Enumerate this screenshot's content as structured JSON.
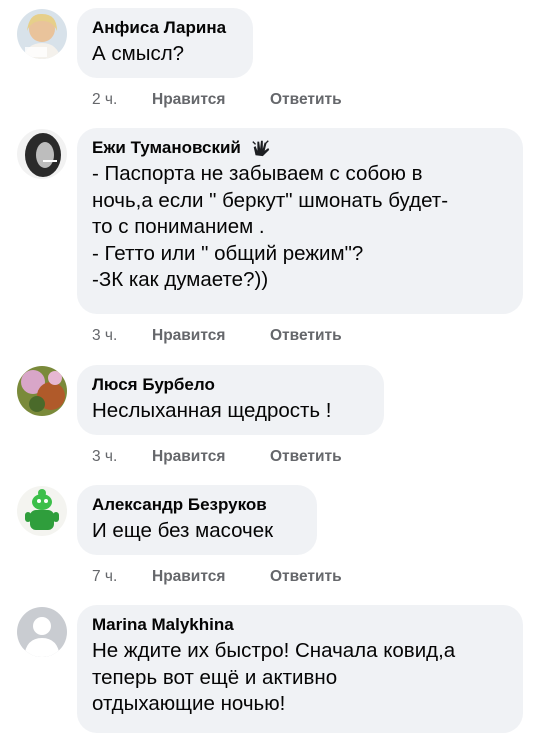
{
  "comments": [
    {
      "author": "Анфиса Ларина",
      "text": "А смысл?",
      "time": "2 ч.",
      "like_label": "Нравится",
      "reply_label": "Ответить",
      "avatar_icon": "profile-photo-icon"
    },
    {
      "author": "Ежи Тумановский",
      "text": "- Паспорта не забываем с собою в\nночь,а если \" беркут\" шмонать будет-\nто с пониманием .\n- Гетто или \" общий режим\"?\n-ЗК как думаете?))",
      "time": "3 ч.",
      "like_label": "Нравится",
      "reply_label": "Ответить",
      "avatar_icon": "profile-photo-icon",
      "badge_icon": "top-fan-hand-icon"
    },
    {
      "author": "Люся Бурбело",
      "text": "Неслыханная щедрость !",
      "time": "3 ч.",
      "like_label": "Нравится",
      "reply_label": "Ответить",
      "avatar_icon": "profile-photo-icon"
    },
    {
      "author": "Александр Безруков",
      "text": "И еще без масочек",
      "time": "7 ч.",
      "like_label": "Нравится",
      "reply_label": "Ответить",
      "avatar_icon": "profile-photo-icon"
    },
    {
      "author": "Marina Malykhina",
      "text": "Не ждите их быстро! Сначала ковид,а\nтеперь вот ещё и активно\nотдыхающие ночью!",
      "avatar_icon": "default-avatar-icon"
    }
  ],
  "colors": {
    "bubble": "#f0f2f5",
    "meta": "#65676b",
    "text": "#050505"
  }
}
